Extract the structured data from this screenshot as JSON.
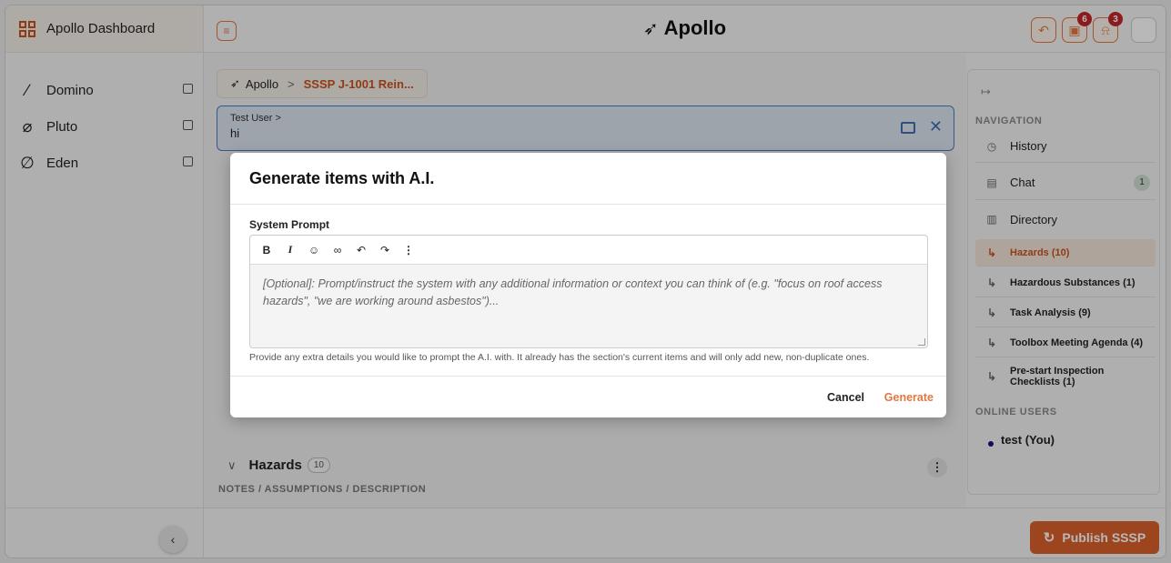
{
  "sidebar": {
    "brand": "Apollo Dashboard",
    "items": [
      {
        "label": "Domino",
        "icon": "domino-icon"
      },
      {
        "label": "Pluto",
        "icon": "pluto-icon"
      },
      {
        "label": "Eden",
        "icon": "eden-icon"
      }
    ]
  },
  "header": {
    "title": "Apollo",
    "notifications_badge": "6",
    "alerts_badge": "3"
  },
  "breadcrumb": {
    "root": "Apollo",
    "separator": ">",
    "current": "SSSP J-1001 Rein..."
  },
  "chat": {
    "user": "Test User >",
    "message": "hi"
  },
  "section": {
    "title": "Hazards",
    "count": "10",
    "notes_label": "NOTES / ASSUMPTIONS / DESCRIPTION"
  },
  "right_panel": {
    "navigation_label": "NAVIGATION",
    "items": [
      {
        "label": "History"
      },
      {
        "label": "Chat",
        "badge": "1"
      },
      {
        "label": "Directory"
      },
      {
        "label": "Hazards (10)"
      },
      {
        "label": "Hazardous Substances (1)"
      },
      {
        "label": "Task Analysis (9)"
      },
      {
        "label": "Toolbox Meeting Agenda (4)"
      },
      {
        "label": "Pre-start Inspection Checklists (1)"
      }
    ],
    "online_label": "ONLINE USERS",
    "user": "test (You)"
  },
  "footer": {
    "publish_label": "Publish SSSP"
  },
  "modal": {
    "title": "Generate items with A.I.",
    "field_label": "System Prompt",
    "placeholder": "[Optional]: Prompt/instruct the system with any additional information or context you can think of (e.g. \"focus on roof access hazards\", \"we are working around asbestos\")...",
    "helper": "Provide any extra details you would like to prompt the A.I. with. It already has the section's current items and will only add new, non-duplicate ones.",
    "cancel_label": "Cancel",
    "generate_label": "Generate"
  },
  "colors": {
    "accent": "#d9602b",
    "chat_border": "#4b7cc4"
  }
}
